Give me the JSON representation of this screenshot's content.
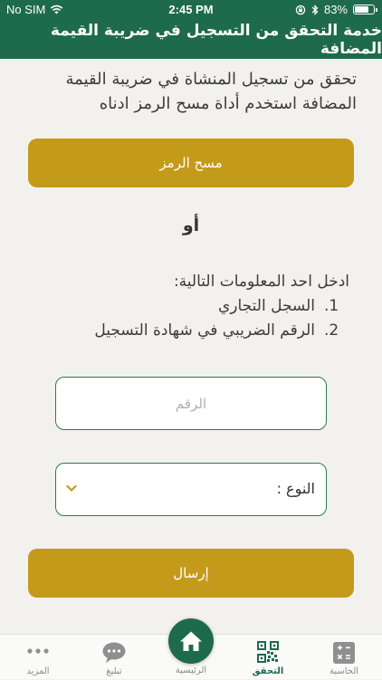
{
  "status_bar": {
    "carrier": "No SIM",
    "time": "2:45 PM",
    "battery_percent": "83%",
    "battery_level": 0.83,
    "icons": [
      "wifi-icon",
      "orientation-lock-icon",
      "bluetooth-icon",
      "battery-icon"
    ]
  },
  "header": {
    "title": "خدمة التحقق من التسجيل في ضريبة القيمة المضافة"
  },
  "intro": {
    "text": "تحقق من تسجيل المنشاة في ضريبة القيمة المضافة استخدم أداة مسح الرمز ادناه"
  },
  "scan_button": {
    "label": "مسح الرمز"
  },
  "or_text": "أو",
  "instructions": {
    "heading": "ادخل احد المعلومات التالية:",
    "items": [
      {
        "num": "1.",
        "text": "السجل التجاري"
      },
      {
        "num": "2.",
        "text": "الرقم الضريبي في شهادة التسجيل"
      }
    ]
  },
  "number_field": {
    "value": "",
    "placeholder": "الرقم"
  },
  "type_select": {
    "label": "النوع :"
  },
  "submit_button": {
    "label": "إرسال"
  },
  "tab_bar": {
    "calculator": "الحاسبة",
    "verify": "التحقق",
    "home": "الرئيسية",
    "notify": "تبليغ",
    "more": "المزيد",
    "active_tab": "verify"
  },
  "colors": {
    "primary_green": "#1e6a4d",
    "gold": "#c49a1a",
    "background": "#f2f1ed"
  }
}
